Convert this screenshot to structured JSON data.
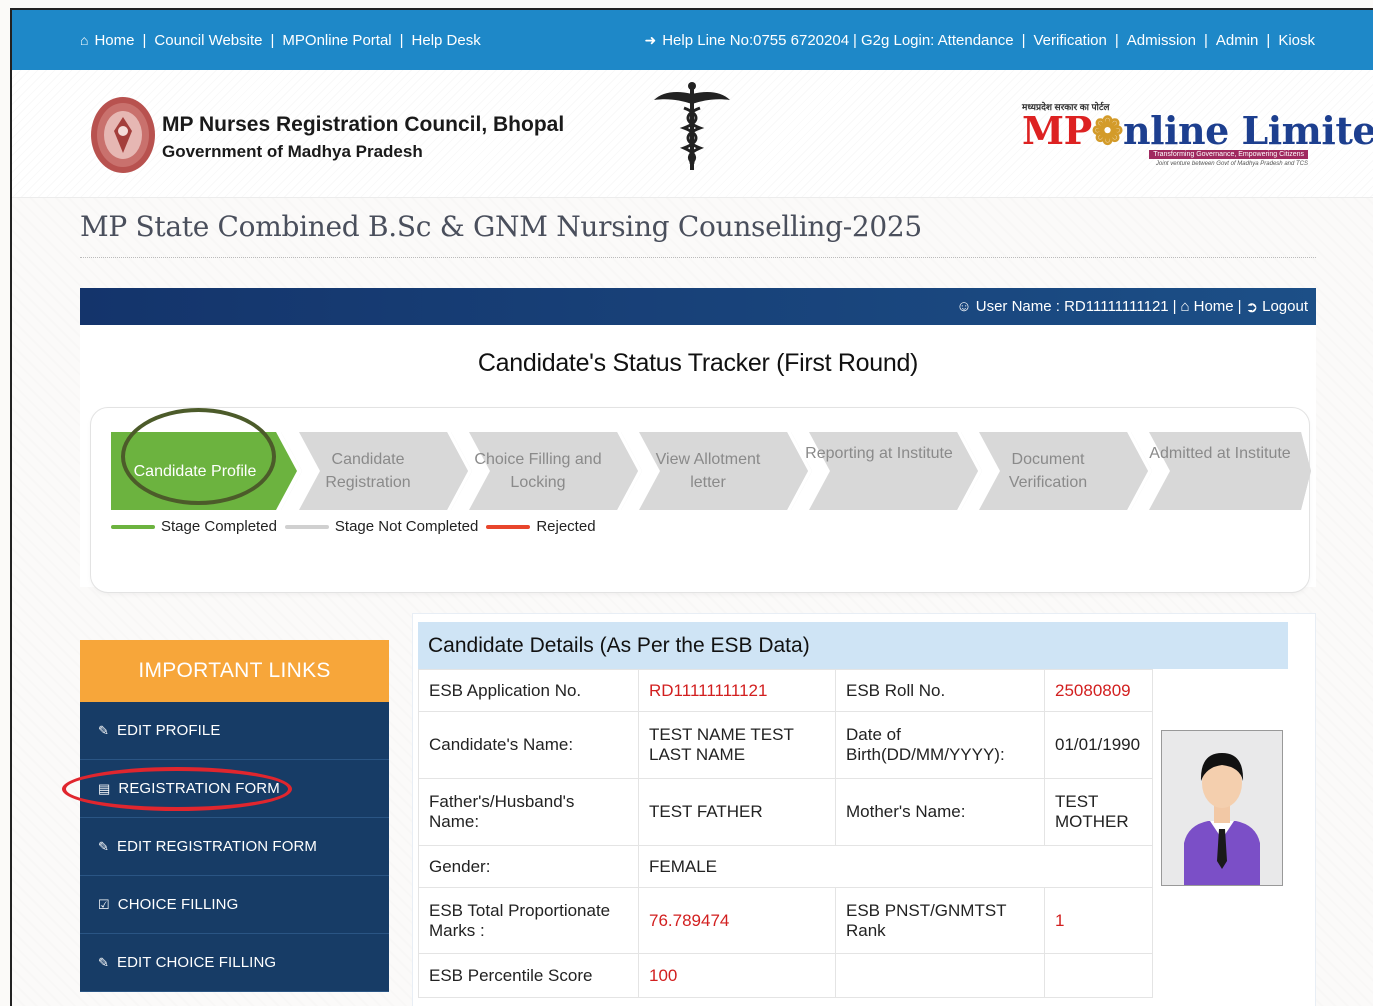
{
  "topnav": {
    "left_links": [
      "Home",
      "Council Website",
      "MPOnline Portal",
      "Help Desk"
    ],
    "helpline": "Help Line No:0755 6720204",
    "g2g_label": "G2g Login: Attendance",
    "right_links": [
      "Verification",
      "Admission",
      "Admin",
      "Kiosk"
    ]
  },
  "header": {
    "council_name": "MP Nurses Registration Council, Bhopal",
    "council_sub": "Government of Madhya Pradesh",
    "mp_tag": "मध्यप्रदेश सरकार का पोर्टल",
    "mp_strap": "Transforming Governance, Empowering Citizens",
    "mp_jv": "Joint venture between Govt of Madhya Pradesh and TCS"
  },
  "page_title": "MP State Combined B.Sc & GNM Nursing Counselling-2025",
  "userbar": {
    "user_label": "User Name : RD11111111121",
    "home": "Home",
    "logout": "Logout"
  },
  "tracker": {
    "title": "Candidate's Status Tracker (First Round)",
    "stages": [
      {
        "label": "Candidate Profile",
        "status": "completed"
      },
      {
        "label": "Candidate Registration",
        "status": "not-completed"
      },
      {
        "label": "Choice Filling and Locking",
        "status": "not-completed"
      },
      {
        "label": "View Allotment letter",
        "status": "not-completed"
      },
      {
        "label": "Reporting at Institute",
        "status": "not-completed"
      },
      {
        "label": "Document Verification",
        "status": "not-completed"
      },
      {
        "label": "Admitted at Institute",
        "status": "not-completed"
      }
    ],
    "legend": {
      "completed": "Stage Completed",
      "not_completed": "Stage Not Completed",
      "rejected": "Rejected"
    },
    "colors": {
      "completed": "#6cb33f",
      "not_completed": "#d8d8d8",
      "rejected": "#e8452c"
    }
  },
  "links": {
    "heading": "IMPORTANT LINKS",
    "items": [
      {
        "label": "EDIT PROFILE",
        "icon": "edit-icon"
      },
      {
        "label": "REGISTRATION FORM",
        "icon": "id-card-icon"
      },
      {
        "label": "EDIT REGISTRATION FORM",
        "icon": "edit-icon"
      },
      {
        "label": "CHOICE FILLING",
        "icon": "checkbox-icon"
      },
      {
        "label": "EDIT CHOICE FILLING",
        "icon": "edit-icon"
      }
    ]
  },
  "details": {
    "heading": "Candidate Details (As Per the ESB Data)",
    "app_no_label": "ESB Application No.",
    "app_no": "RD11111111121",
    "roll_label": "ESB Roll No.",
    "roll": "25080809",
    "name_label": "Candidate's Name:",
    "name": "TEST NAME TEST LAST NAME",
    "dob_label": "Date of Birth(DD/MM/YYYY):",
    "dob": "01/01/1990",
    "father_label": "Father's/Husband's Name:",
    "father": "TEST FATHER",
    "mother_label": "Mother's Name:",
    "mother": "TEST MOTHER",
    "gender_label": "Gender:",
    "gender": "FEMALE",
    "marks_label": "ESB Total Proportionate Marks :",
    "marks": "76.789474",
    "rank_label": "ESB PNST/GNMTST Rank",
    "rank": "1",
    "percentile_label": "ESB Percentile Score",
    "percentile": "100"
  }
}
